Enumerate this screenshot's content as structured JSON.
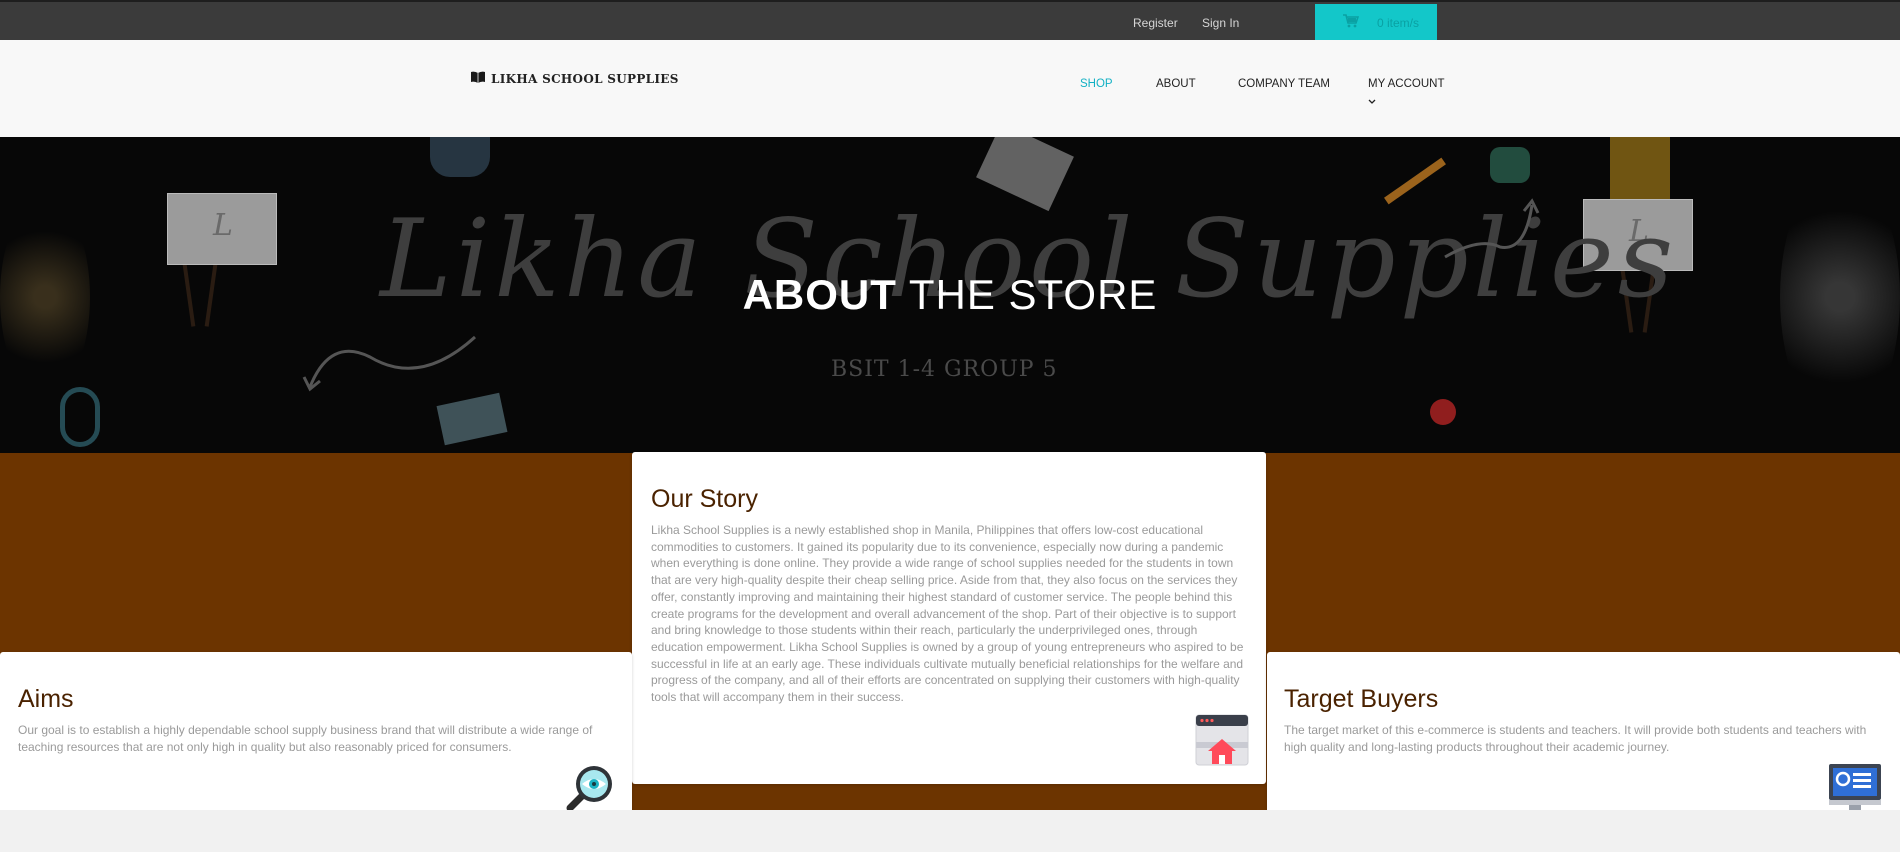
{
  "topbar": {
    "register": "Register",
    "sign_in": "Sign In",
    "cart_label": "0 item/s"
  },
  "navbar": {
    "logo_text": "LIKHA SCHOOL SUPPLIES",
    "items": [
      {
        "label": "SHOP",
        "active": true
      },
      {
        "label": "ABOUT",
        "active": false
      },
      {
        "label": "COMPANY TEAM",
        "active": false
      },
      {
        "label": "MY ACCOUNT",
        "active": false
      }
    ]
  },
  "hero": {
    "script_text": "Likha School Supplies",
    "title_bold": "ABOUT",
    "title_rest": "THE STORE",
    "subtitle": "BSIT 1-4 GROUP 5",
    "easel_letter": "L"
  },
  "cards": {
    "story": {
      "title": "Our Story",
      "body": "Likha School Supplies is a newly established shop in Manila, Philippines that offers low-cost educational commodities to customers. It gained its popularity due to its convenience, especially now during a pandemic when everything is done online. They provide a wide range of school supplies needed for the students in town that are very high-quality despite their cheap selling price. Aside from that, they also focus on the services they offer, constantly improving and maintaining their highest standard of customer service. The people behind this create programs for the development and overall advancement of the shop. Part of their objective is to support and bring knowledge to those students within their reach, particularly the underprivileged ones, through education empowerment. Likha School Supplies is owned by a group of young entrepreneurs who aspired to be successful in life at an early age. These individuals cultivate mutually beneficial relationships for the welfare and progress of the company, and all of their efforts are concentrated on supplying their customers with high-quality tools that will accompany them in their success.",
      "icon": "web-store-icon"
    },
    "aims": {
      "title": "Aims",
      "body": "Our goal is to establish a highly dependable school supply business brand that will distribute a wide range of teaching resources that are not only high in quality but also reasonably priced for consumers.",
      "icon": "magnifier-eye-icon"
    },
    "buyers": {
      "title": "Target Buyers",
      "body": "The target market of this e-commerce is students and teachers. It will provide both students and teachers with high quality and long-lasting products throughout their academic journey.",
      "icon": "monitor-icon"
    }
  },
  "colors": {
    "accent": "#13c7c9",
    "brown": "#6c3400",
    "dark_bar": "#3b3b3b"
  }
}
